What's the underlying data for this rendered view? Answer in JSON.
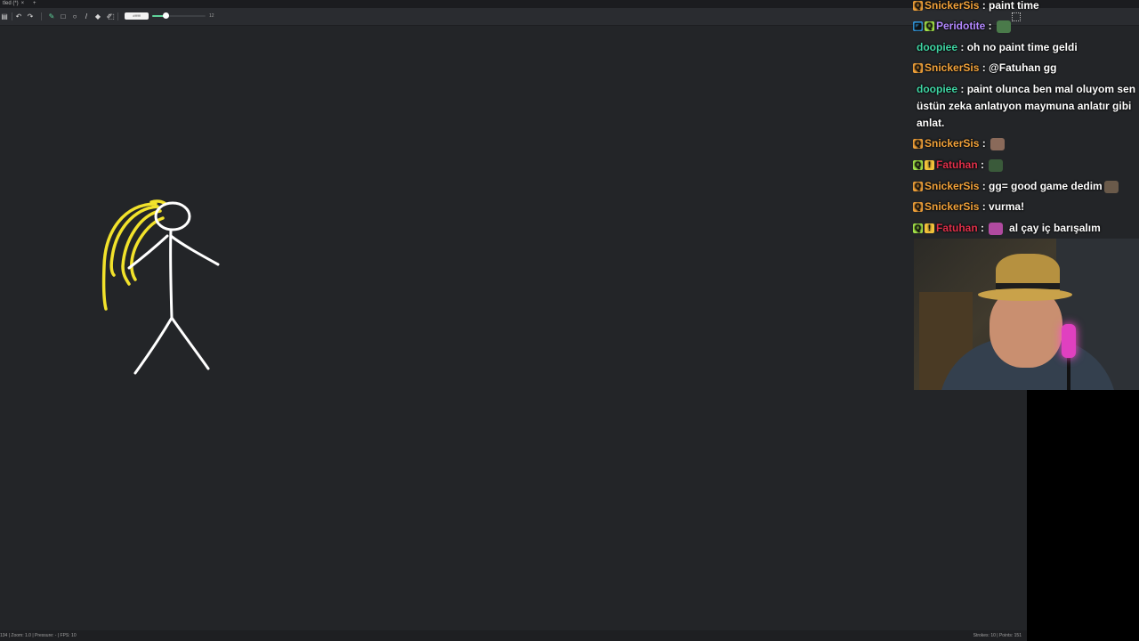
{
  "app": {
    "tab_title": "tled (*)",
    "tab_close": "×",
    "new_tab": "+",
    "toolbar": {
      "tools": [
        {
          "name": "menu-icon",
          "glyph": "▤"
        },
        {
          "name": "undo-icon",
          "glyph": "↶"
        },
        {
          "name": "redo-icon",
          "glyph": "↷"
        },
        {
          "name": "brush-tool-icon",
          "glyph": "✎",
          "active": true
        },
        {
          "name": "rectangle-tool-icon",
          "glyph": "□"
        },
        {
          "name": "ellipse-tool-icon",
          "glyph": "○"
        },
        {
          "name": "line-tool-icon",
          "glyph": "/"
        },
        {
          "name": "fill-tool-icon",
          "glyph": "◆"
        },
        {
          "name": "eraser-tool-icon",
          "glyph": "✐"
        },
        {
          "name": "select-tool-icon",
          "glyph": "⬚"
        }
      ],
      "color_hex": "#ffffff",
      "color_label": "#ffffff",
      "brush_size": "12",
      "brush_size_fraction": 0.25
    },
    "status": {
      "left": "134 | Zoom: 1.0 | Pressure: - | FPS: 10",
      "right": "Strokes: 10 | Points: 151"
    },
    "drawing_colors": {
      "figure": "#ffffff",
      "hair": "#f2e22b",
      "accent": "#5fd39a"
    }
  },
  "chat": {
    "messages": [
      {
        "badges": [
          {
            "name": "q-badge-icon",
            "glyph": "Q",
            "color": "#f2a23a"
          }
        ],
        "user": "SnickerSis",
        "user_color": "#f2a23a",
        "sep": " : ",
        "text": "paint time",
        "emote": null
      },
      {
        "badges": [
          {
            "name": "twitch-badge-icon",
            "glyph": "◪",
            "color": "#3aa7f2"
          },
          {
            "name": "q-badge-icon",
            "glyph": "Q",
            "color": "#a6e64a"
          }
        ],
        "user": "Peridotite",
        "user_color": "#b388ff",
        "sep": " : ",
        "text": "",
        "emote": "#4a7a4a"
      },
      {
        "badges": [],
        "user": "doopiee",
        "user_color": "#3fd6a4",
        "sep": " : ",
        "text": "oh no paint time geldi",
        "emote": null
      },
      {
        "badges": [
          {
            "name": "q-badge-icon",
            "glyph": "Q",
            "color": "#f2a23a"
          }
        ],
        "user": "SnickerSis",
        "user_color": "#f2a23a",
        "sep": " : ",
        "text": "@Fatuhan gg",
        "emote": null
      },
      {
        "badges": [],
        "user": "doopiee",
        "user_color": "#3fd6a4",
        "sep": " : ",
        "text": "paint olunca ben mal oluyom sen üstün zeka anlatıyon maymuna anlatır gibi anlat.",
        "emote": null
      },
      {
        "badges": [
          {
            "name": "q-badge-icon",
            "glyph": "Q",
            "color": "#f2a23a"
          }
        ],
        "user": "SnickerSis",
        "user_color": "#f2a23a",
        "sep": " : ",
        "text": "",
        "emote": "#8a6a5a"
      },
      {
        "badges": [
          {
            "name": "q-badge-icon",
            "glyph": "Q",
            "color": "#a6e64a"
          },
          {
            "name": "warning-badge-icon",
            "glyph": "!",
            "color": "#f2c23a"
          }
        ],
        "user": "Fatuhan",
        "user_color": "#e0304a",
        "sep": " : ",
        "text": "",
        "emote": "#3a5a3a"
      },
      {
        "badges": [
          {
            "name": "q-badge-icon",
            "glyph": "Q",
            "color": "#f2a23a"
          }
        ],
        "user": "SnickerSis",
        "user_color": "#f2a23a",
        "sep": " : ",
        "text": "gg= good game dedim",
        "emote": "#6a5a4a"
      },
      {
        "badges": [
          {
            "name": "q-badge-icon",
            "glyph": "Q",
            "color": "#f2a23a"
          }
        ],
        "user": "SnickerSis",
        "user_color": "#f2a23a",
        "sep": " : ",
        "text": "vurma!",
        "emote": null
      },
      {
        "badges": [
          {
            "name": "q-badge-icon",
            "glyph": "Q",
            "color": "#a6e64a"
          },
          {
            "name": "warning-badge-icon",
            "glyph": "!",
            "color": "#f2c23a"
          }
        ],
        "user": "Fatuhan",
        "user_color": "#e0304a",
        "sep": " : ",
        "text": "al çay iç barışalım",
        "emote": "#b04aa0",
        "emote_first": true
      }
    ]
  }
}
